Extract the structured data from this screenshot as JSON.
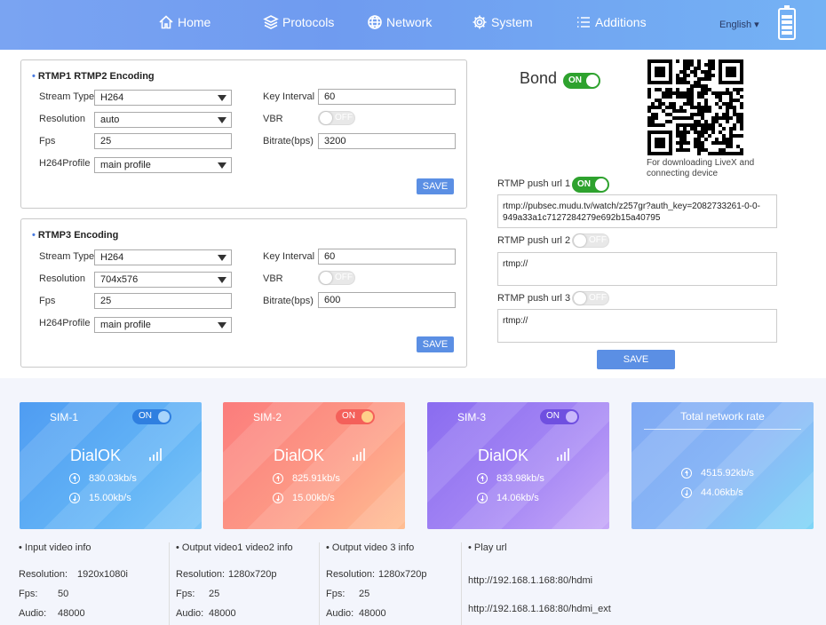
{
  "nav": {
    "items": [
      {
        "label": "Home",
        "icon": "home-icon"
      },
      {
        "label": "Protocols",
        "icon": "layers-icon"
      },
      {
        "label": "Network",
        "icon": "globe-icon"
      },
      {
        "label": "System",
        "icon": "gear-icon"
      },
      {
        "label": "Additions",
        "icon": "list-icon"
      }
    ],
    "language": "English ▾"
  },
  "rtmp12": {
    "title": "RTMP1 RTMP2 Encoding",
    "stream_type_label": "Stream Type",
    "stream_type": "H264",
    "resolution_label": "Resolution",
    "resolution": "auto",
    "fps_label": "Fps",
    "fps": "25",
    "profile_label": "H264Profile",
    "profile": "main profile",
    "key_interval_label": "Key Interval",
    "key_interval": "60",
    "vbr_label": "VBR",
    "vbr_state": "OFF",
    "bitrate_label": "Bitrate(bps)",
    "bitrate": "3200",
    "save_label": "SAVE"
  },
  "rtmp3": {
    "title": "RTMP3 Encoding",
    "stream_type_label": "Stream Type",
    "stream_type": "H264",
    "resolution_label": "Resolution",
    "resolution": "704x576",
    "fps_label": "Fps",
    "fps": "25",
    "profile_label": "H264Profile",
    "profile": "main profile",
    "key_interval_label": "Key Interval",
    "key_interval": "60",
    "vbr_label": "VBR",
    "vbr_state": "OFF",
    "bitrate_label": "Bitrate(bps)",
    "bitrate": "600",
    "save_label": "SAVE"
  },
  "bond": {
    "label": "Bond",
    "state": "ON"
  },
  "qr": {
    "caption": "For downloading LiveX and connecting device"
  },
  "push": {
    "url1_label": "RTMP push url 1",
    "url1_state": "ON",
    "url1": "rtmp://pubsec.mudu.tv/watch/z257gr?auth_key=2082733261-0-0-949a33a1c7127284279e692b15a40795",
    "url2_label": "RTMP push url 2",
    "url2_state": "OFF",
    "url2": "rtmp://",
    "url3_label": "RTMP push url 3",
    "url3_state": "OFF",
    "url3": "rtmp://",
    "save_label": "SAVE"
  },
  "sims": [
    {
      "name": "SIM-1",
      "state": "ON",
      "status": "DialOK",
      "up": "830.03kb/s",
      "down": "15.00kb/s"
    },
    {
      "name": "SIM-2",
      "state": "ON",
      "status": "DialOK",
      "up": "825.91kb/s",
      "down": "15.00kb/s"
    },
    {
      "name": "SIM-3",
      "state": "ON",
      "status": "DialOK",
      "up": "833.98kb/s",
      "down": "14.06kb/s"
    }
  ],
  "total": {
    "title": "Total network rate",
    "up": "4515.92kb/s",
    "down": "44.06kb/s"
  },
  "info": {
    "input": {
      "title": "Input video info",
      "res_label": "Resolution:",
      "res": "1920x1080i",
      "fps_label": "Fps:",
      "fps": "50",
      "audio_label": "Audio:",
      "audio": "48000"
    },
    "out12": {
      "title": "Output video1 video2 info",
      "res_label": "Resolution:",
      "res": "1280x720p",
      "fps_label": "Fps:",
      "fps": "25",
      "audio_label": "Audio:",
      "audio": "48000"
    },
    "out3": {
      "title": "Output video 3 info",
      "res_label": "Resolution:",
      "res": "1280x720p",
      "fps_label": "Fps:",
      "fps": "25",
      "audio_label": "Audio:",
      "audio": "48000"
    },
    "play": {
      "title": "Play url",
      "url1": "http://192.168.1.168:80/hdmi",
      "url2": "http://192.168.1.168:80/hdmi_ext"
    }
  },
  "colors": {
    "accent": "#5b8fe4",
    "toggle_on": "#2ea22e",
    "sim1": "#5eaaf4",
    "sim2": "#fb8d80",
    "sim3": "#9b7ef2",
    "total": "#87b3f5"
  }
}
